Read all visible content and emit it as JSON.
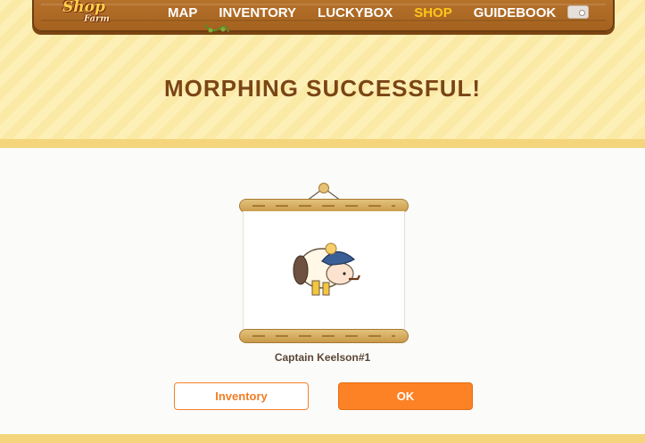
{
  "nav": {
    "logo_line1": "Shop",
    "logo_line2": "Farm",
    "items": [
      {
        "label": "MAP"
      },
      {
        "label": "INVENTORY"
      },
      {
        "label": "LUCKYBOX"
      },
      {
        "label": "SHOP",
        "active": true
      },
      {
        "label": "GUIDEBOOK"
      }
    ],
    "wallet_icon": "wallet-icon"
  },
  "main": {
    "title": "MORPHING SUCCESSFUL!",
    "character_name": "Captain Keelson#1",
    "character_icon": "sheep-captain-icon"
  },
  "actions": {
    "inventory_label": "Inventory",
    "ok_label": "OK"
  },
  "colors": {
    "accent": "#fd8226",
    "active_nav": "#ffc61a",
    "title": "#7a4516",
    "band": "#f5d57c"
  }
}
